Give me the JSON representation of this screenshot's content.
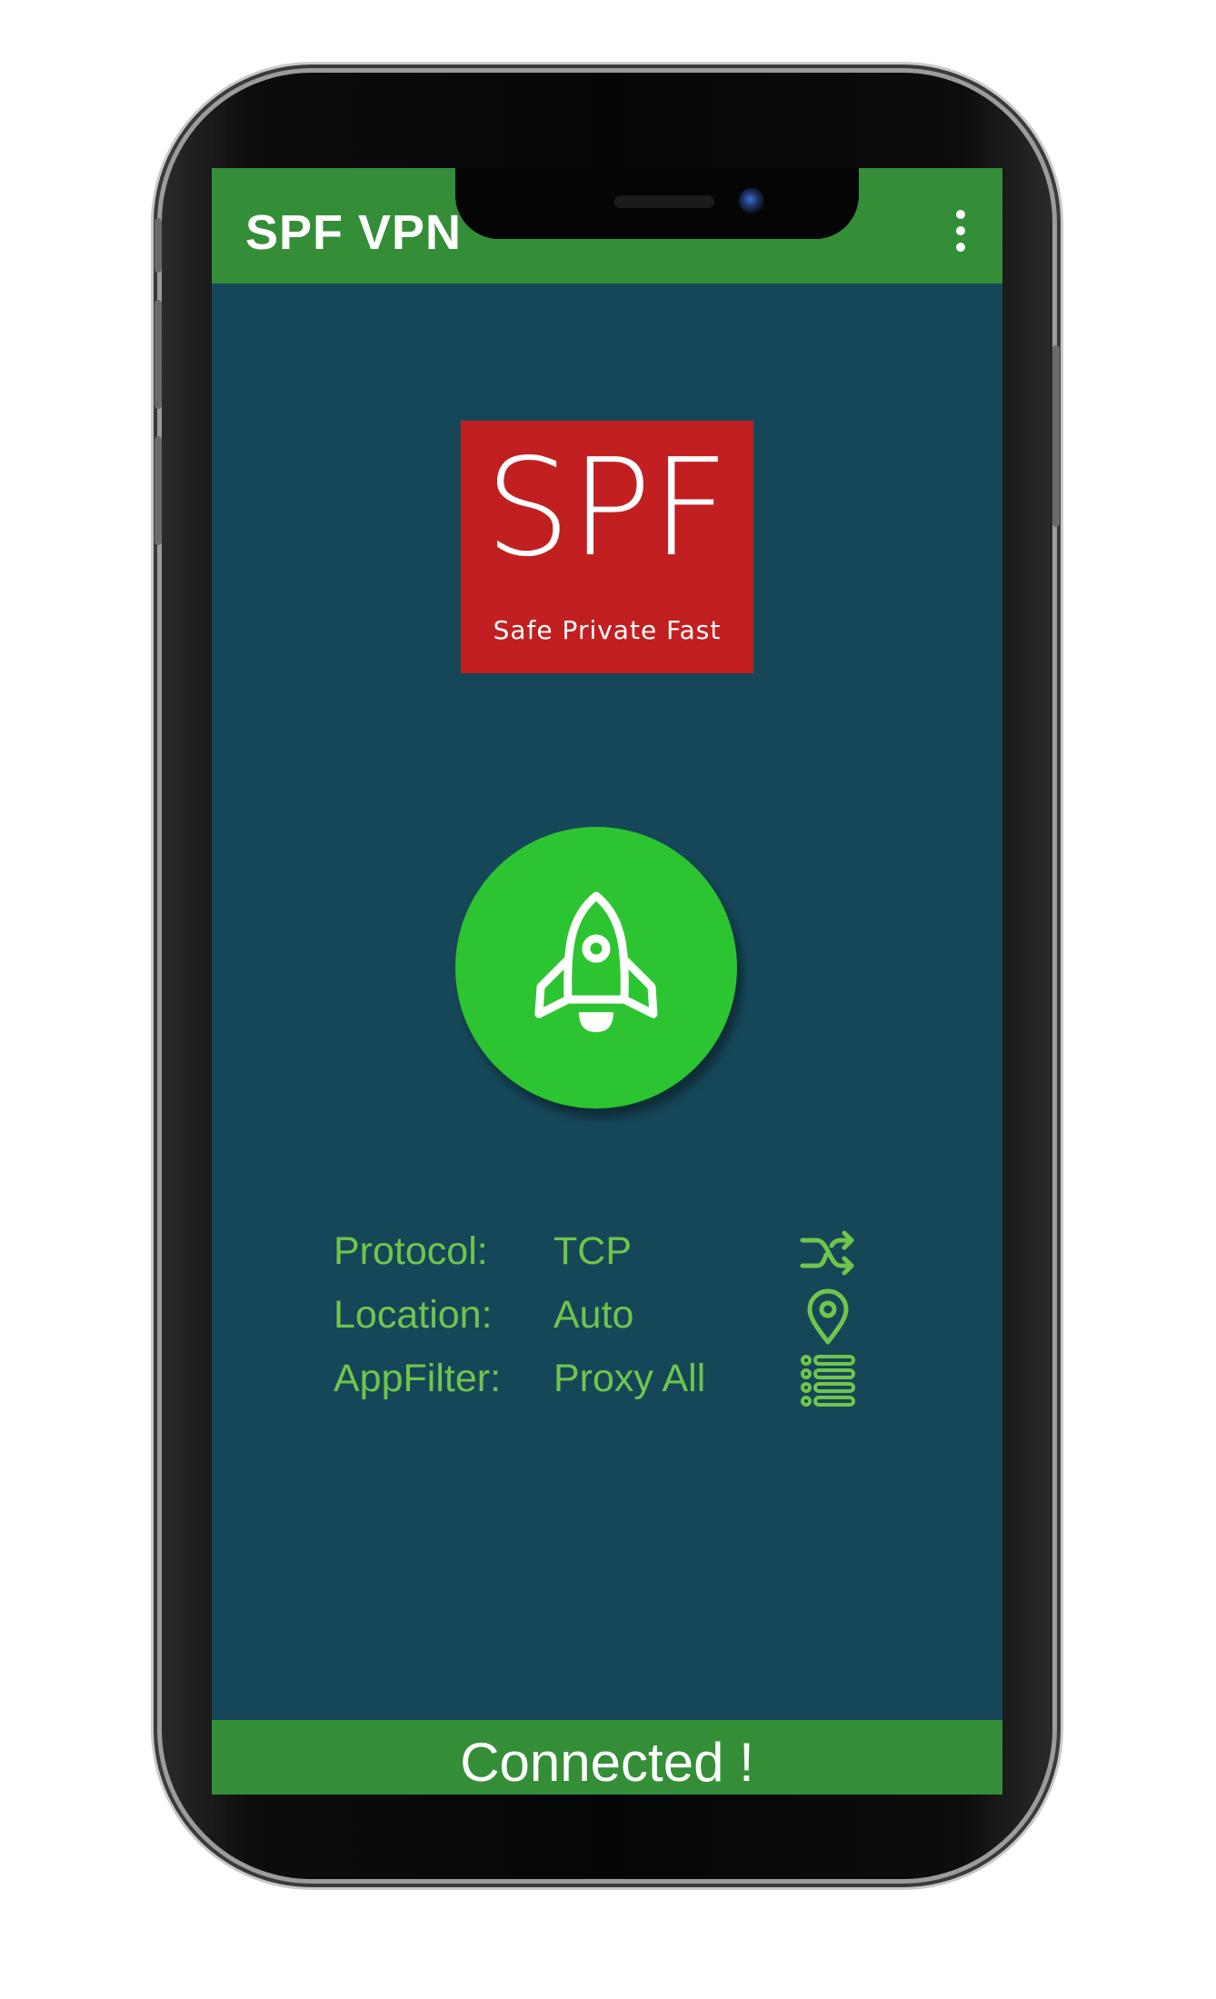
{
  "app_bar": {
    "title": "SPF VPN",
    "menu_icon": "more-vert-icon"
  },
  "logo": {
    "mark": "SPF",
    "tagline": "Safe Private Fast",
    "background_color": "#c21f20"
  },
  "connect_button": {
    "icon": "rocket-icon",
    "color": "#2dc431"
  },
  "info": [
    {
      "label": "Protocol:",
      "value": "TCP",
      "icon": "shuffle-icon"
    },
    {
      "label": "Location:",
      "value": "Auto",
      "icon": "location-pin-icon"
    },
    {
      "label": "AppFilter:",
      "value": "Proxy All",
      "icon": "list-icon"
    }
  ],
  "status": {
    "text": "Connected !"
  },
  "colors": {
    "primary_green": "#348e37",
    "background": "#164759",
    "info_text": "#6fc64b"
  }
}
